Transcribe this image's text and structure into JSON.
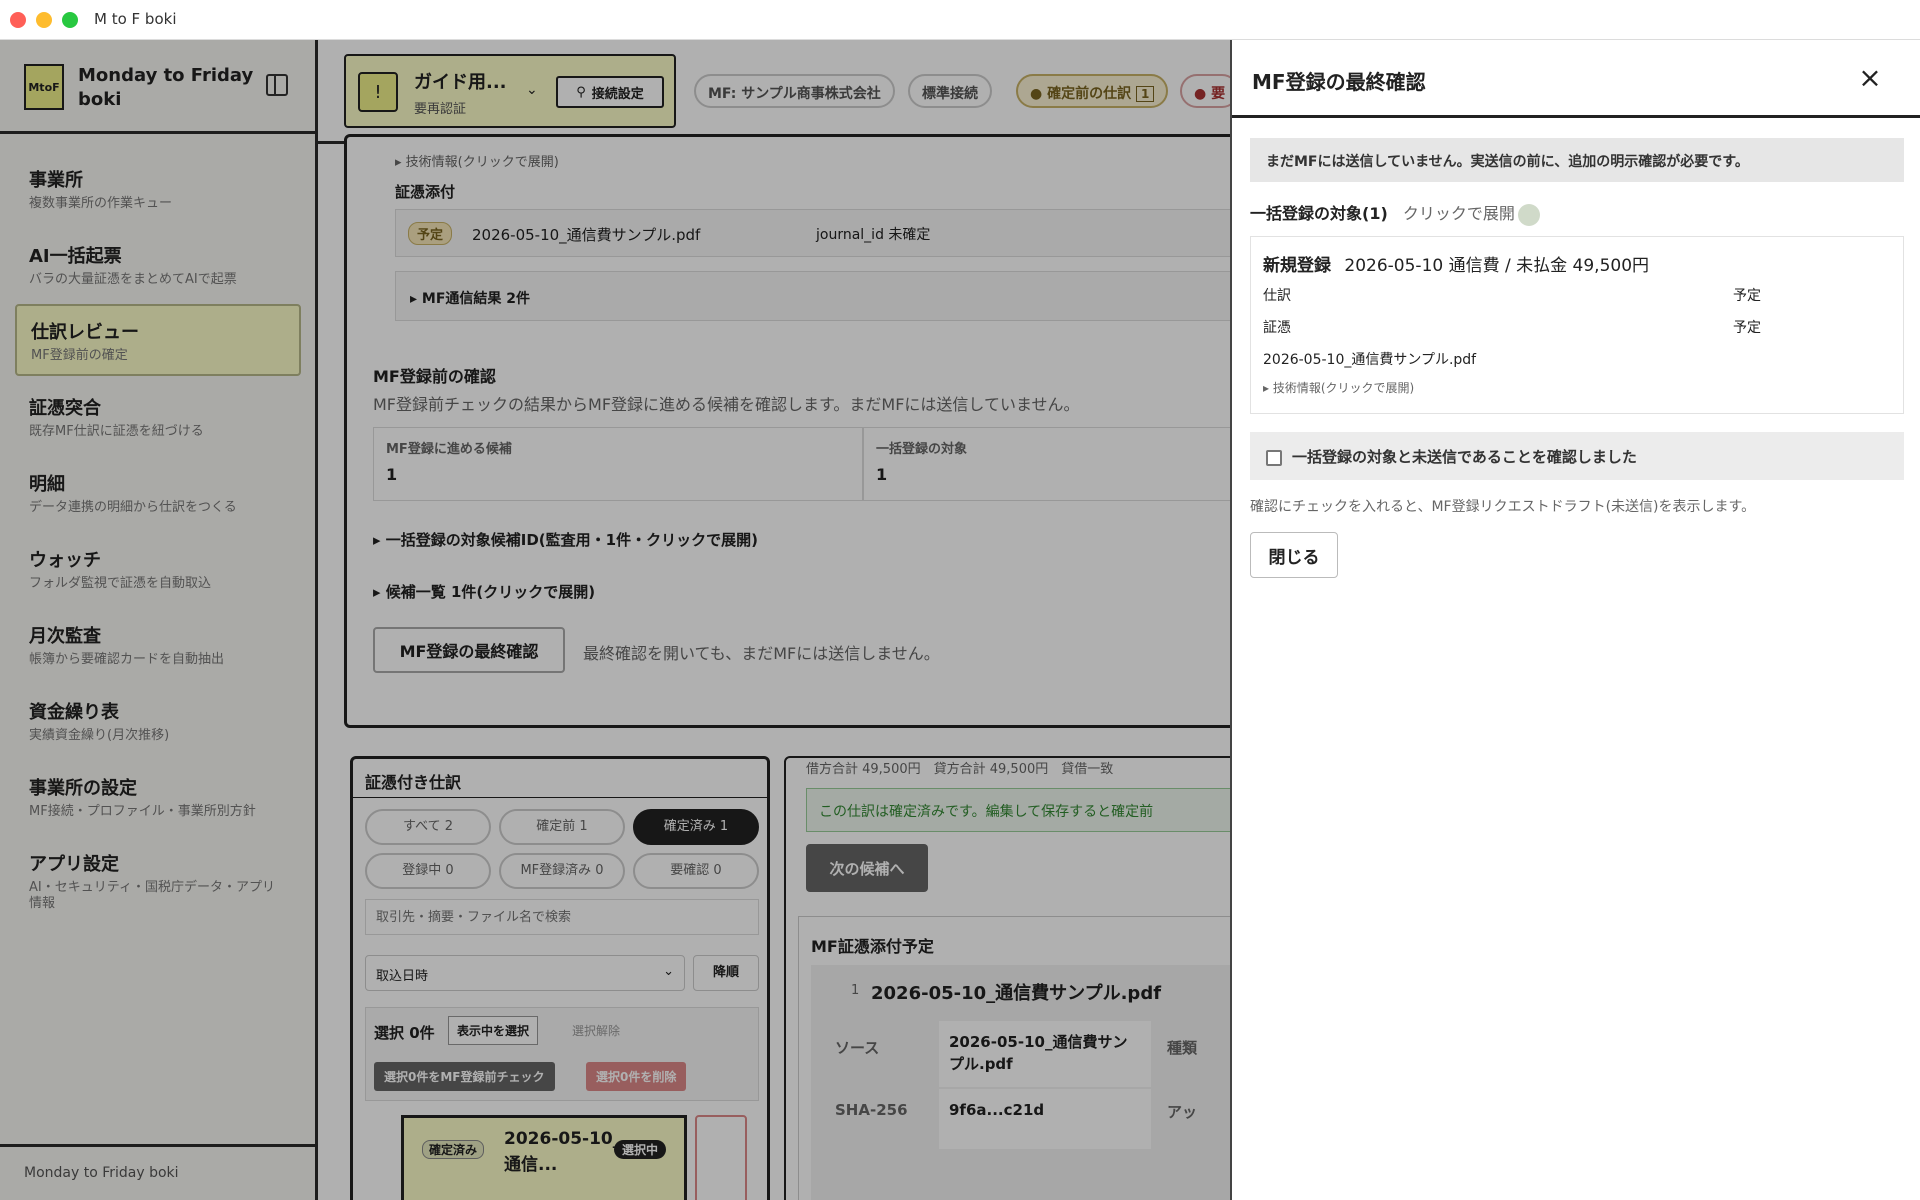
{
  "window": {
    "title": "M to F boki"
  },
  "sidebar": {
    "logo_text": "MtoF",
    "brand": "Monday to Friday boki",
    "items": [
      {
        "label": "事業所",
        "sub": "複数事業所の作業キュー"
      },
      {
        "label": "AI一括起票",
        "sub": "バラの大量証憑をまとめてAIで起票"
      },
      {
        "label": "仕訳レビュー",
        "sub": "MF登録前の確定"
      },
      {
        "label": "証憑突合",
        "sub": "既存MF仕訳に証憑を紐づける"
      },
      {
        "label": "明細",
        "sub": "データ連携の明細から仕訳をつくる"
      },
      {
        "label": "ウォッチ",
        "sub": "フォルダ監視で証憑を自動取込"
      },
      {
        "label": "月次監査",
        "sub": "帳簿から要確認カードを自動抽出"
      },
      {
        "label": "資金繰り表",
        "sub": "実績資金繰り(月次推移)"
      },
      {
        "label": "事業所の設定",
        "sub": "MF接続・プロファイル・事業所別方針"
      },
      {
        "label": "アプリ設定",
        "sub": "AI・セキュリティ・国税庁データ・アプリ情報"
      }
    ],
    "footer": "Monday to Friday boki"
  },
  "topbar": {
    "guide_title": "ガイド用...",
    "guide_sub": "要再認証",
    "connect_button": "接続設定",
    "chips": [
      "MF: サンプル商事株式会社",
      "標準接続",
      "確定前の仕訳",
      "要"
    ],
    "pending_count": "1"
  },
  "main": {
    "tech_info": "▸ 技術情報(クリックで展開)",
    "evidence_heading": "証憑添付",
    "evidence_badge": "予定",
    "evidence_file": "2026-05-10_通信費サンプル.pdf",
    "journal_id": "journal_id 未確定",
    "mf_results": "▸ MF通信結果 2件",
    "precheck": {
      "title": "MF登録前の確認",
      "desc": "MF登録前チェックの結果からMF登録に進める候補を確認します。まだMFには送信していません。",
      "candidates_label": "MF登録に進める候補",
      "candidates_value": "1",
      "targets_label": "一括登録の対象",
      "targets_value": "1",
      "ids_toggle": "▸ 一括登録の対象候補ID(監査用・1件・クリックで展開)",
      "list_toggle": "▸ 候補一覧 1件(クリックで展開)",
      "final_button": "MF登録の最終確認",
      "final_note": "最終確認を開いても、まだMFには送信しません。"
    },
    "list_panel": {
      "title": "証憑付き仕訳",
      "filters": [
        "すべて 2",
        "確定前 1",
        "確定済み 1",
        "登録中 0",
        "MF登録済み 0",
        "要確認 0"
      ],
      "search_placeholder": "取引先・摘要・ファイル名で検索",
      "sort_value": "取込日時",
      "sort_order": "降順",
      "selected": "選択 0件",
      "select_visible": "表示中を選択",
      "clear_selection": "選択解除",
      "check_button": "選択0件をMF登録前チェック",
      "delete_button": "選択0件を削除",
      "item_badge": "確定済み",
      "item_title": "2026-05-10_通信...",
      "item_state": "選択中"
    },
    "detail": {
      "totals": "借方合計 49,500円　貸方合計 49,500円　貸借一致",
      "confirmed_note": "この仕訳は確定済みです。編集して保存すると確定前",
      "next_button": "次の候補へ",
      "attach_title": "MF証憑添付予定",
      "attach_index": "1",
      "attach_file": "2026-05-10_通信費サンプル.pdf",
      "source_label": "ソース",
      "source_value": "2026-05-10_通信費サンプル.pdf",
      "sha_label": "SHA-256",
      "sha_value": "9f6a...c21d",
      "col3a": "種類",
      "col3b": "アッ"
    }
  },
  "drawer": {
    "title": "MF登録の最終確認",
    "warning": "まだMFには送信していません。実送信の前に、追加の明示確認が必要です。",
    "target_label": "一括登録の対象(1)",
    "target_hint": "クリックで展開",
    "entry": {
      "kind": "新規登録",
      "summary": "2026-05-10 通信費 / 未払金 49,500円",
      "row1_label": "仕訳",
      "row1_value": "予定",
      "row2_label": "証憑",
      "row2_value": "予定",
      "file": "2026-05-10_通信費サンプル.pdf",
      "tech": "▸ 技術情報(クリックで展開)"
    },
    "confirm_label": "一括登録の対象と未送信であることを確認しました",
    "hint": "確認にチェックを入れると、MF登録リクエストドラフト(未送信)を表示します。",
    "close_button": "閉じる"
  },
  "colors": {
    "accent": "#eef08a",
    "highlight": "#fbfcc9",
    "overlay": "rgba(0,0,0,0.31)",
    "border": "#2a2a2a"
  }
}
